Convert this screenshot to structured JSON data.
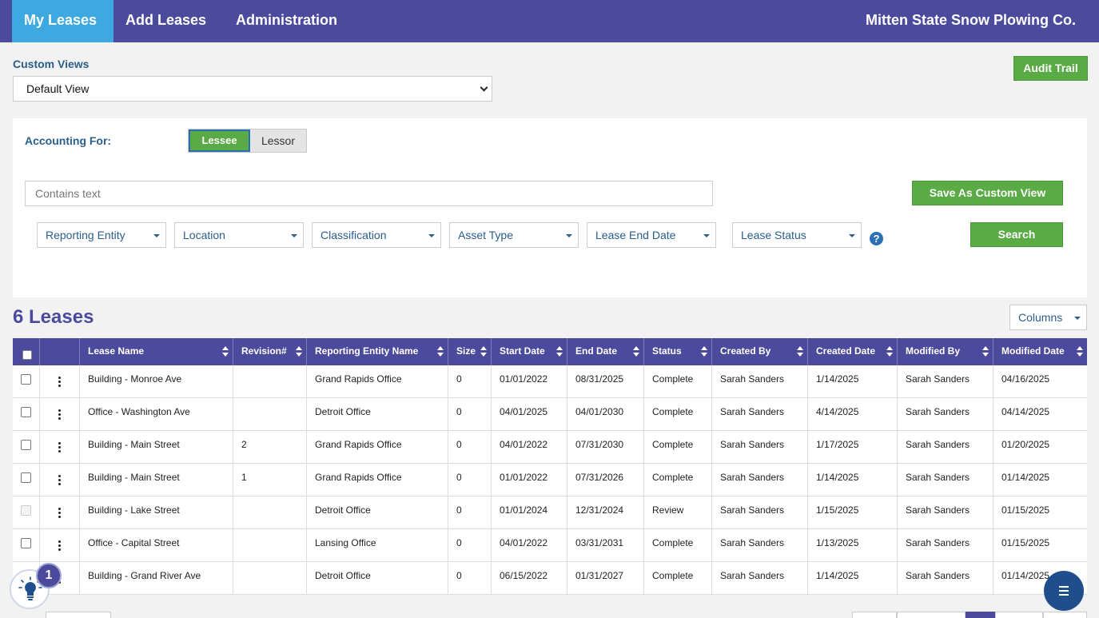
{
  "nav": {
    "tabs": [
      {
        "label": "My Leases",
        "active": true
      },
      {
        "label": "Add Leases"
      },
      {
        "label": "Administration"
      }
    ],
    "company": "Mitten State Snow Plowing Co."
  },
  "custom_views": {
    "label": "Custom Views",
    "selected": "Default View"
  },
  "audit_trail": "Audit Trail",
  "filters": {
    "accounting_for_label": "Accounting For:",
    "toggle": {
      "on": "Lessee",
      "off": "Lessor"
    },
    "search_placeholder": "Contains text",
    "save_custom_view": "Save As Custom View",
    "search": "Search",
    "dropdowns": [
      "Reporting Entity",
      "Location",
      "Classification",
      "Asset Type",
      "Lease End Date",
      "Lease Status"
    ],
    "help": "?"
  },
  "leases": {
    "count_title": "6 Leases",
    "columns_btn": "Columns",
    "headers": [
      "Lease Name",
      "Revision#",
      "Reporting Entity Name",
      "Size",
      "Start Date",
      "End Date",
      "Status",
      "Created By",
      "Created Date",
      "Modified By",
      "Modified Date"
    ],
    "rows": [
      [
        "Building - Monroe Ave",
        "",
        "Grand Rapids Office",
        "0",
        "01/01/2022",
        "08/31/2025",
        "Complete",
        "Sarah Sanders",
        "1/14/2025",
        "Sarah Sanders",
        "04/16/2025"
      ],
      [
        "Office - Washington Ave",
        "",
        "Detroit Office",
        "0",
        "04/01/2025",
        "04/01/2030",
        "Complete",
        "Sarah Sanders",
        "4/14/2025",
        "Sarah Sanders",
        "04/14/2025"
      ],
      [
        "Building - Main Street",
        "2",
        "Grand Rapids Office",
        "0",
        "04/01/2022",
        "07/31/2030",
        "Complete",
        "Sarah Sanders",
        "1/17/2025",
        "Sarah Sanders",
        "01/20/2025"
      ],
      [
        "Building - Main Street",
        "1",
        "Grand Rapids Office",
        "0",
        "01/01/2022",
        "07/31/2026",
        "Complete",
        "Sarah Sanders",
        "1/14/2025",
        "Sarah Sanders",
        "01/14/2025"
      ],
      [
        "Building - Lake Street",
        "",
        "Detroit Office",
        "0",
        "01/01/2024",
        "12/31/2024",
        "Review",
        "Sarah Sanders",
        "1/15/2025",
        "Sarah Sanders",
        "01/15/2025"
      ],
      [
        "Office - Capital Street",
        "",
        "Lansing Office",
        "0",
        "04/01/2022",
        "03/31/2031",
        "Complete",
        "Sarah Sanders",
        "1/13/2025",
        "Sarah Sanders",
        "01/15/2025"
      ],
      [
        "Building - Grand River Ave",
        "",
        "Detroit Office",
        "0",
        "06/15/2022",
        "01/31/2027",
        "Complete",
        "Sarah Sanders",
        "1/14/2025",
        "Sarah Sanders",
        "01/14/2025"
      ]
    ]
  },
  "hints_badge": "1",
  "icons": {
    "help": "question-circle-icon",
    "hints": "lightbulb-icon",
    "menu": "hamburger-menu-icon",
    "row_menu": "kebab-menu-icon"
  },
  "colors": {
    "nav": "#4b4a9c",
    "active_tab": "#3ea8e0",
    "green": "#5aaa46",
    "link": "#2a5d8c"
  }
}
